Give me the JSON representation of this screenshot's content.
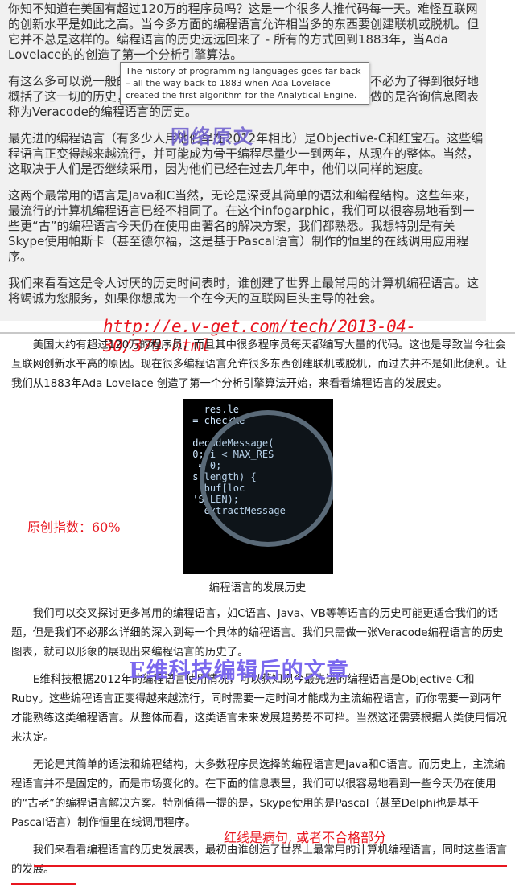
{
  "top_section": {
    "p1": "你知不知道在美国有超过120万的程序员吗？这是一个很多人推代码每一天。难怪互联网的创新水平是如此之高。当今多方面的编程语言允许相当多的东西要创建联机或脱机。但它并不总是这样的。编程语言的历史远远回来了 - 所有的方式回到1883年，当Ada Lovelace的的创造了第一个分析引擎算法。",
    "p2": "有这么多可以说一般的编程语言历史，很容易在细节中迷失。但我们不必为了得到很好地概括了这一切的历史，探入到每一个具体的编程语言。我们真正需要做的是咨询信息图表称为Veracode的编程语言的历史。",
    "p3": "最先进的编程语言（有多少人用他们早在2012年相比）是Objective-C和红宝石。这些编程语言正变得越来越流行，并可能成为骨干编程尽量少一到两年，从现在的整体。当然，这取决于人们是否继续采用，因为他们已经在过去几年中，他们以同样的速度。",
    "p4": "这两个最常用的语言是Java和C当然，无论是深受其简单的语法和编程结构。这些年来，最流行的计算机编程语言已经不相同了。在这个infogarphic，我们可以很容易地看到一些更“古”的编程语言今天仍在使用由著名的解决方案，我们都熟悉。我想特别是有关Skype使用帕斯卡（甚至德尔福，这是基于Pascal语言）制作的恒里的在线调用应用程序。",
    "p5": "我们来看看这是令人讨厌的历史时间表时，谁创建了世界上最常用的计算机编程语言。这将竭诚为您服务，如果你想成为一个在今天的互联网巨头主导的社会。"
  },
  "tooltip": "The history of programming languages goes far back – all the way back to 1883 when Ada Lovelace created the first algorithm for the Analytical Engine.",
  "watermark_top": "网络原文",
  "source_url": "http://e.v-get.com/tech/2013-04-30/379.html",
  "bottom_section": {
    "p1": "美国大约有超过120万的程序员，而且其中很多程序员每天都编写大量的代码。这也是导致当今社会互联网创新水平高的原因。现在很多编程语言允许很多东西创建联机或脱机，而过去并不是如此便利。让我们从1883年Ada Lovelace 创造了第一个分析引擎算法开始，来看看编程语言的发展史。",
    "p2": "我们可以交叉探讨更多常用的编程语言，如C语言、Java、VB等等语言的历史可能更适合我们的话题，但是我们不必那么详细的深入到每一个具体的编程语言。我们只需做一张Veracode编程语言的历史图表，就可以形象的展现出来编程语言的历史了。",
    "p3": "E维科技根据2012年的编程语言使用情况，可以获知现今最先进的编程语言是Objective-C和Ruby。这些编程语言正变得越来越流行，同时需要一定时间才能成为主流编程语言，而你需要一到两年才能熟练这类编程语言。从整体而看，这类语言未来发展趋势势不可挡。当然这还需要根据人类使用情况来决定。",
    "p4": "无论是其简单的语法和编程结构，大多数程序员选择的编程语言是Java和C语言。而历史上，主流编程语言并不是固定的，而是市场变化的。在下面的信息表里，我们可以很容易地看到一些今天仍在使用的“古老”的编程语言解决方案。特别值得一提的是，Skype使用的是Pascal（甚至Delphi也是基于Pascal语言）制作恒里在线调用程序。",
    "p5": "我们来看看编程语言的历史发展表，最初由谁创造了世界上最常用的计算机编程语言，同时这些语言的发展。"
  },
  "figure": {
    "code_lines": "   res.le\n = checkRe\n\n decodeMessage(\n 0; i < MAX_RES\n  = 0;\n s.length) {\n   buf[loc\n 'S_LEN);\n   extractMessage",
    "caption": "编程语言的发展历史"
  },
  "originality_score": "原创指数：60%",
  "watermark_bottom": "E维科技编辑后的文章",
  "annotation_note": "红线是病句, 或者不合格部分",
  "colors": {
    "red": "#e8161f",
    "purple": "#7b68ee"
  }
}
